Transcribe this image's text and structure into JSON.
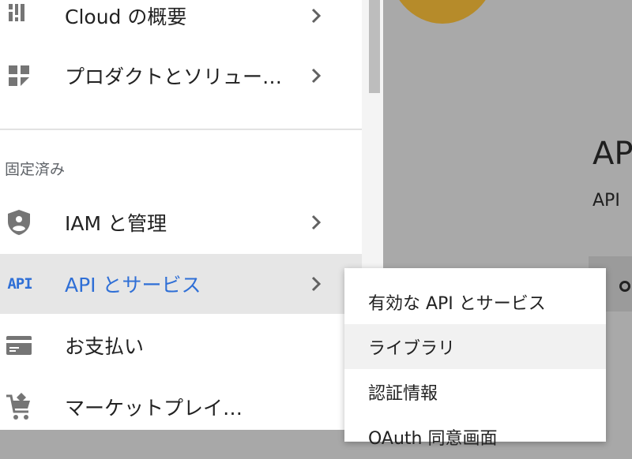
{
  "background": {
    "title": "AP",
    "subtitle": "API"
  },
  "nav": {
    "items_top": [
      {
        "label": "Cloud の概要",
        "icon": "dashboard-icon"
      },
      {
        "label": "プロダクトとソリュー…",
        "icon": "products-grid-icon"
      }
    ],
    "section_label": "固定済み",
    "pinned": [
      {
        "label": "IAM と管理",
        "icon": "shield-person-icon"
      },
      {
        "label": "API とサービス",
        "icon": "api-icon",
        "icon_text": "API"
      },
      {
        "label": "お支払い",
        "icon": "credit-card-icon"
      },
      {
        "label": "マーケットプレイ…",
        "icon": "marketplace-cart-icon"
      }
    ]
  },
  "submenu": {
    "items": [
      {
        "label": "有効な API とサービス"
      },
      {
        "label": "ライブラリ"
      },
      {
        "label": "認証情報"
      },
      {
        "label": "OAuth 同意画面"
      }
    ]
  },
  "colors": {
    "accent": "#2f6fd6",
    "icon_gray": "#757575"
  }
}
